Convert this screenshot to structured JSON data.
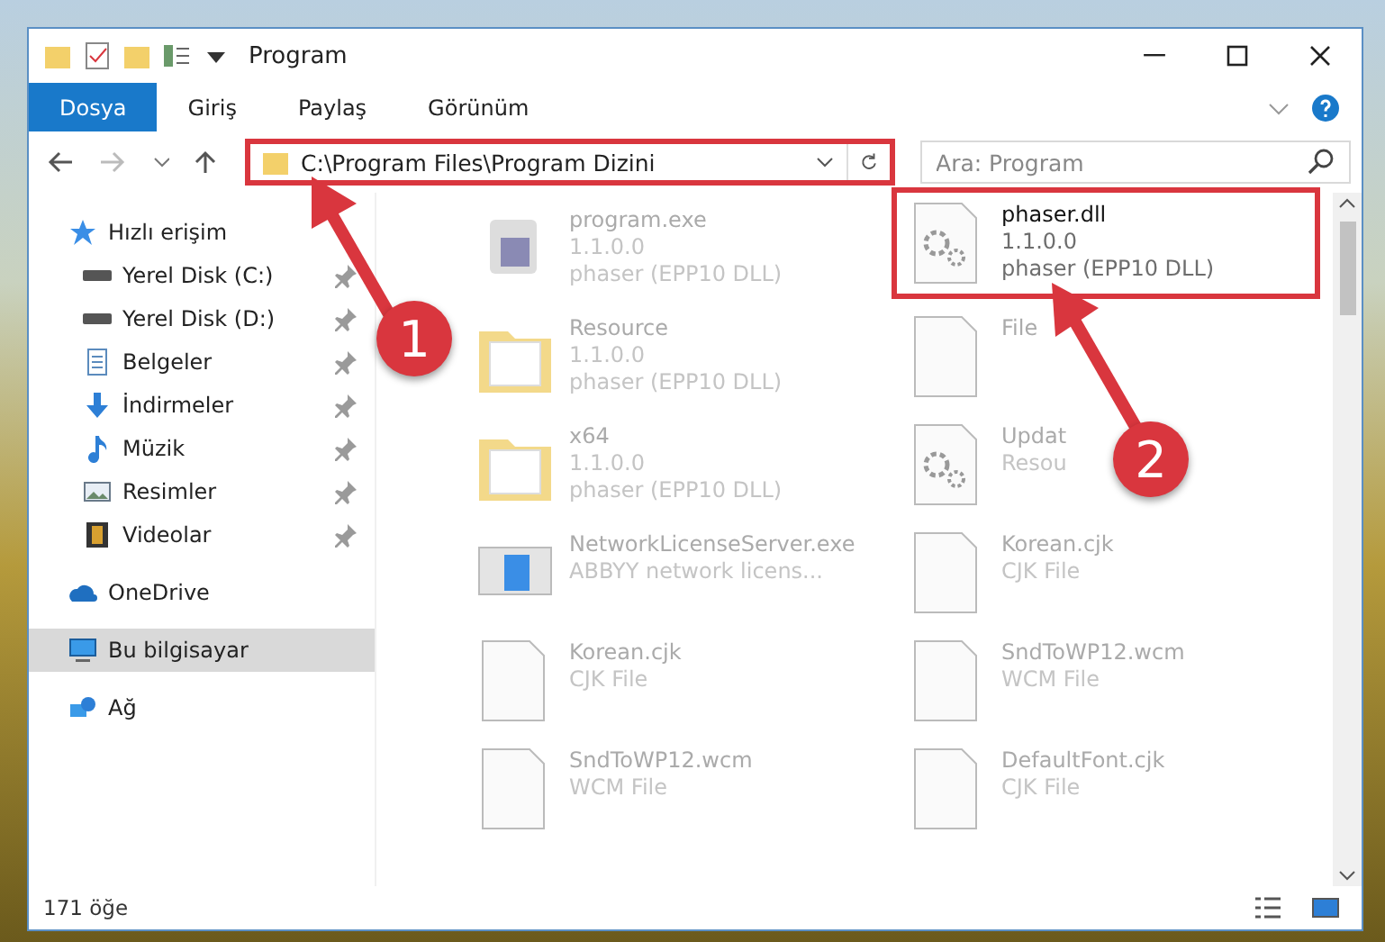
{
  "window": {
    "title": "Program"
  },
  "ribbon_tabs": [
    {
      "label": "Dosya",
      "selected": true
    },
    {
      "label": "Giriş",
      "selected": false
    },
    {
      "label": "Paylaş",
      "selected": false
    },
    {
      "label": "Görünüm",
      "selected": false
    }
  ],
  "address": {
    "path": "C:\\Program Files\\Program Dizini",
    "highlighted": true
  },
  "search": {
    "placeholder": "Ara: Program"
  },
  "sidebar": {
    "items": [
      {
        "label": "Hızlı erişim",
        "kind": "star",
        "pinned": false,
        "selected": false,
        "children": [
          {
            "label": "Yerel Disk (C:)",
            "kind": "disk",
            "pinned": true,
            "selected": false
          },
          {
            "label": "Yerel Disk (D:)",
            "kind": "disk",
            "pinned": true,
            "selected": false
          },
          {
            "label": "Belgeler",
            "kind": "document",
            "pinned": true,
            "selected": false
          },
          {
            "label": "İndirmeler",
            "kind": "download",
            "pinned": true,
            "selected": false
          },
          {
            "label": "Müzik",
            "kind": "music",
            "pinned": true,
            "selected": false
          },
          {
            "label": "Resimler",
            "kind": "picture",
            "pinned": true,
            "selected": false
          },
          {
            "label": "Videolar",
            "kind": "video",
            "pinned": true,
            "selected": false
          }
        ]
      },
      {
        "label": "OneDrive",
        "kind": "cloud",
        "pinned": false,
        "selected": false
      },
      {
        "label": "Bu bilgisayar",
        "kind": "computer",
        "pinned": false,
        "selected": true
      },
      {
        "label": "Ağ",
        "kind": "network",
        "pinned": false,
        "selected": false
      }
    ]
  },
  "files": [
    {
      "kind": "exe",
      "faded": true,
      "highlighted": false,
      "lines": [
        "program.exe",
        "1.1.0.0",
        "phaser (EPP10 DLL)"
      ]
    },
    {
      "kind": "dll",
      "faded": false,
      "highlighted": true,
      "lines": [
        "phaser.dll",
        "1.1.0.0",
        "phaser (EPP10 DLL)"
      ]
    },
    {
      "kind": "folder",
      "faded": true,
      "highlighted": false,
      "lines": [
        "Resource",
        "1.1.0.0",
        "phaser (EPP10 DLL)"
      ]
    },
    {
      "kind": "file",
      "faded": true,
      "highlighted": false,
      "lines": [
        "File"
      ]
    },
    {
      "kind": "folder",
      "faded": true,
      "highlighted": false,
      "lines": [
        "x64",
        "1.1.0.0",
        "phaser (EPP10 DLL)"
      ]
    },
    {
      "kind": "dll",
      "faded": true,
      "highlighted": false,
      "lines": [
        "Updat",
        "Resou"
      ]
    },
    {
      "kind": "app",
      "faded": true,
      "highlighted": false,
      "lines": [
        "NetworkLicenseServer.exe",
        "ABBYY network licens..."
      ]
    },
    {
      "kind": "file",
      "faded": true,
      "highlighted": false,
      "lines": [
        "Korean.cjk",
        "CJK File"
      ]
    },
    {
      "kind": "file",
      "faded": true,
      "highlighted": false,
      "lines": [
        "Korean.cjk",
        "CJK File"
      ]
    },
    {
      "kind": "file",
      "faded": true,
      "highlighted": false,
      "lines": [
        "SndToWP12.wcm",
        "WCM File"
      ]
    },
    {
      "kind": "file",
      "faded": true,
      "highlighted": false,
      "lines": [
        "SndToWP12.wcm",
        "WCM File"
      ]
    },
    {
      "kind": "file",
      "faded": true,
      "highlighted": false,
      "lines": [
        "DefaultFont.cjk",
        "CJK File"
      ]
    }
  ],
  "status_bar": {
    "count": "171 öğe"
  },
  "callouts": [
    {
      "number": "1"
    },
    {
      "number": "2"
    }
  ]
}
